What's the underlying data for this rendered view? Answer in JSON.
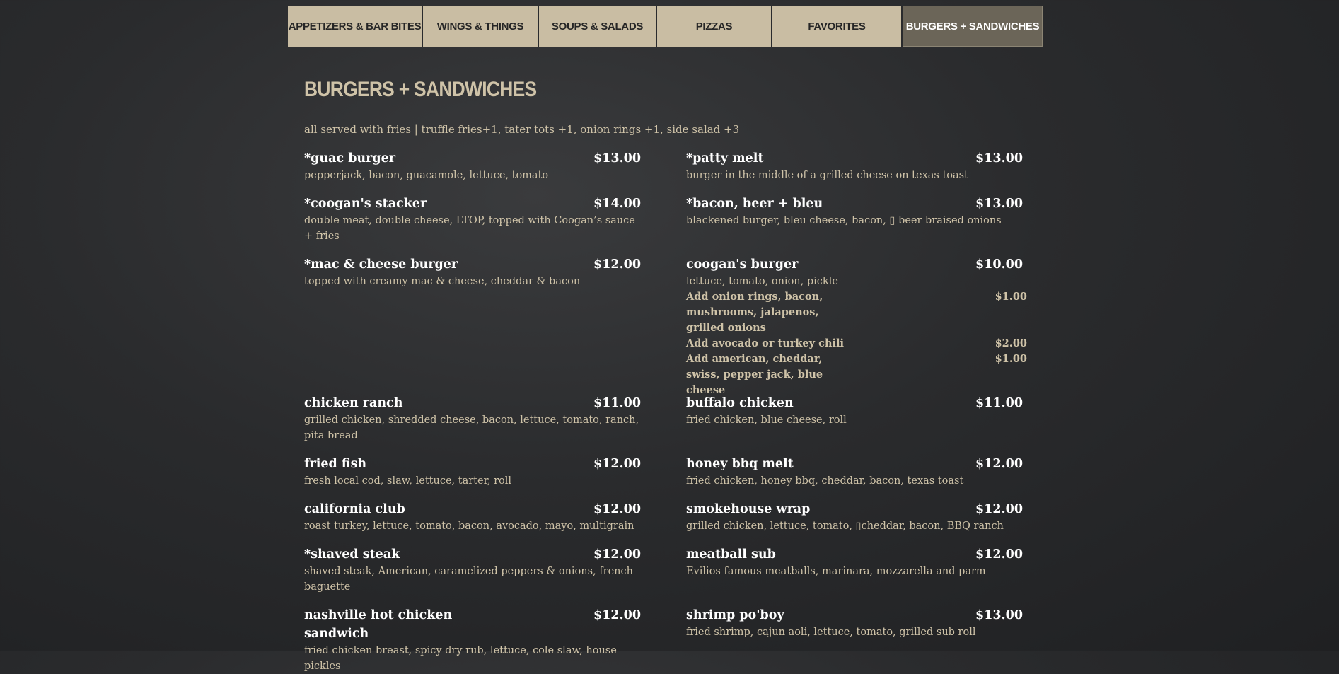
{
  "tabs": [
    {
      "label": "APPETIZERS & BAR BITES"
    },
    {
      "label": "WINGS & THINGS"
    },
    {
      "label": "SOUPS & SALADS"
    },
    {
      "label": "PIZZAS"
    },
    {
      "label": "FAVORITES"
    },
    {
      "label": "BURGERS + SANDWICHES",
      "active": true
    }
  ],
  "section": {
    "title": "BURGERS + SANDWICHES",
    "intro": "all served with fries | truffle fries+1, tater tots +1, onion rings +1, side salad +3"
  },
  "left_items": [
    {
      "name": "*guac burger",
      "price": "$13.00",
      "desc": "pepperjack, bacon, guacamole, lettuce, tomato"
    },
    {
      "name": "*coogan's stacker",
      "price": "$14.00",
      "desc": "double meat, double cheese, LTOP, topped with Coogan’s sauce + fries"
    },
    {
      "name": "*mac & cheese burger",
      "price": "$12.00",
      "desc": "topped with creamy mac & cheese, cheddar & bacon"
    },
    {
      "name": "chicken ranch",
      "price": "$11.00",
      "desc": "grilled chicken, shredded cheese, bacon, lettuce, tomato, ranch, pita bread"
    },
    {
      "name": "fried fish",
      "price": "$12.00",
      "desc": "fresh local cod, slaw, lettuce, tarter, roll"
    },
    {
      "name": "california club",
      "price": "$12.00",
      "desc": "roast turkey, lettuce, tomato, bacon, avocado, mayo, multigrain"
    },
    {
      "name": "*shaved steak",
      "price": "$12.00",
      "desc": "shaved steak, American, caramelized peppers & onions, french baguette"
    },
    {
      "name": "nashville hot chicken sandwich",
      "price": "$12.00",
      "desc": "fried chicken breast, spicy dry rub, lettuce, cole slaw, house pickles"
    }
  ],
  "right_items": [
    {
      "name": "*patty melt",
      "price": "$13.00",
      "desc": "burger in the middle of a grilled cheese on texas toast"
    },
    {
      "name": "*bacon, beer + bleu",
      "price": "$13.00",
      "desc": "blackened burger, bleu cheese, bacon, ▯ beer braised onions"
    },
    {
      "name": "coogan's burger",
      "price": "$10.00",
      "desc": "lettuce, tomato, onion, pickle"
    },
    {
      "name": "buffalo chicken",
      "price": "$11.00",
      "desc": "fried chicken, blue cheese, roll"
    },
    {
      "name": "honey bbq melt",
      "price": "$12.00",
      "desc": "fried chicken, honey bbq, cheddar, bacon, texas toast"
    },
    {
      "name": "smokehouse wrap",
      "price": "$12.00",
      "desc": "grilled chicken, lettuce, tomato, ▯cheddar, bacon, BBQ ranch"
    },
    {
      "name": "meatball sub",
      "price": "$12.00",
      "desc": "Evilios famous meatballs, marinara, mozzarella and parm"
    },
    {
      "name": "shrimp po'boy",
      "price": "$13.00",
      "desc": "fried shrimp, cajun aoli, lettuce, tomato, grilled sub roll"
    }
  ],
  "addons": [
    {
      "label": "Add onion rings, bacon, mushrooms, jalapenos, grilled onions",
      "price": "$1.00"
    },
    {
      "label": "Add avocado or turkey chili",
      "price": "$2.00"
    },
    {
      "label": "Add american, cheddar, swiss, pepper jack, blue cheese",
      "price": "$1.00"
    }
  ]
}
